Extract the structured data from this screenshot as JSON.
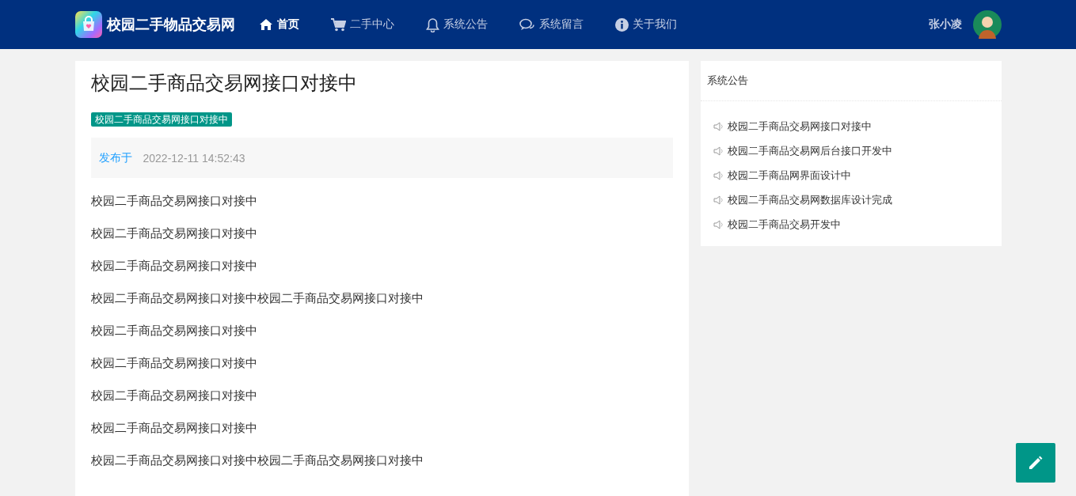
{
  "header": {
    "site_name": "校园二手物品交易网",
    "nav": [
      {
        "label": "首页",
        "kind": "home",
        "selected": true
      },
      {
        "label": "二手中心",
        "kind": "cart",
        "selected": false
      },
      {
        "label": "系统公告",
        "kind": "bell",
        "selected": false
      },
      {
        "label": "系统留言",
        "kind": "chat",
        "selected": false
      },
      {
        "label": "关于我们",
        "kind": "info",
        "selected": false
      }
    ],
    "user_name": "张小凌"
  },
  "article": {
    "title": "校园二手商品交易网接口对接中",
    "tag": "校园二手商品交易网接口对接中",
    "published_label": "发布于",
    "published_time": "2022-12-11 14:52:43",
    "paragraphs": [
      "校园二手商品交易网接口对接中",
      "校园二手商品交易网接口对接中",
      "校园二手商品交易网接口对接中",
      "校园二手商品交易网接口对接中校园二手商品交易网接口对接中",
      "校园二手商品交易网接口对接中",
      "校园二手商品交易网接口对接中",
      "校园二手商品交易网接口对接中",
      "校园二手商品交易网接口对接中",
      "校园二手商品交易网接口对接中校园二手商品交易网接口对接中"
    ]
  },
  "sidebar": {
    "title": "系统公告",
    "items": [
      "校园二手商品交易网接口对接中",
      "校园二手商品交易网后台接口开发中",
      "校园二手商品网界面设计中",
      "校园二手商品交易网数据库设计完成",
      "校园二手商品交易开发中"
    ]
  }
}
